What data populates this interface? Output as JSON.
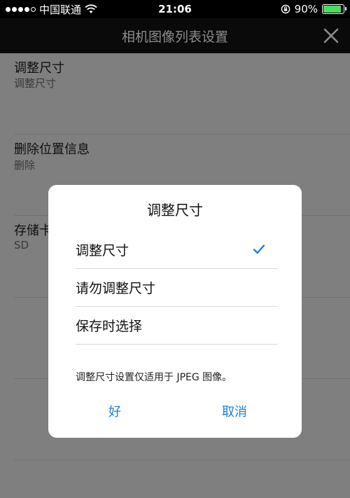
{
  "status_bar": {
    "carrier": "中国联通",
    "time": "21:06",
    "battery": "90%",
    "battery_level": 0.9,
    "colors": {
      "battery_fill": "#4cd964"
    }
  },
  "nav": {
    "title": "相机图像列表设置",
    "close_icon": "close-icon"
  },
  "settings": [
    {
      "title": "调整尺寸",
      "subtitle": "调整尺寸"
    },
    {
      "title": "删除位置信息",
      "subtitle": "删除"
    },
    {
      "title": "存储卡",
      "subtitle": "SD"
    }
  ],
  "dialog": {
    "title": "调整尺寸",
    "options": [
      {
        "label": "调整尺寸",
        "selected": true
      },
      {
        "label": "请勿调整尺寸",
        "selected": false
      },
      {
        "label": "保存时选择",
        "selected": false
      }
    ],
    "note": "调整尺寸设置仅适用于 JPEG 图像。",
    "ok_label": "好",
    "cancel_label": "取消",
    "colors": {
      "accent": "#1a7fd6"
    }
  }
}
